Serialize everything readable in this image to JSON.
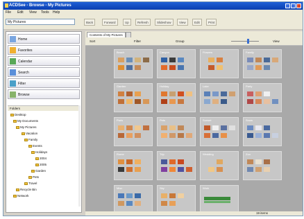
{
  "window": {
    "title": "ACDSee - Browse - My Pictures",
    "controls": [
      "minimize-icon",
      "maximize-icon",
      "close-icon"
    ]
  },
  "menu": [
    "File",
    "Edit",
    "View",
    "Tools",
    "Help"
  ],
  "toolbar": {
    "address": "My Pictures",
    "buttons": [
      "Back",
      "Forward",
      "Up",
      "Refresh",
      "Slideshow",
      "View",
      "Edit",
      "Print"
    ]
  },
  "nav": {
    "items": [
      "Home",
      "Favorites",
      "Calendar",
      "Search",
      "Filter",
      "Browse"
    ],
    "tree_header": "Folders",
    "tree": [
      "Desktop",
      "My Documents",
      "My Pictures",
      "Vacation",
      "Family",
      "Events",
      "Holidays",
      "2004",
      "2005",
      "Garden",
      "Pets",
      "Travel",
      "Recycle Bin",
      "Network"
    ]
  },
  "main": {
    "tab": "Contents of My Pictures",
    "tab2": "",
    "subbar_labels": [
      "Sort",
      "Filter",
      "Group",
      "View"
    ],
    "zoom_level": 0.6,
    "folders": [
      "Beach",
      "Canyon",
      "Flowers",
      "Family",
      "Garden",
      "Holiday",
      "Lake",
      "Party",
      "Paris",
      "Pets",
      "Sunset",
      "Snow",
      "Rome",
      "Trip",
      "Wedding",
      "Zoo",
      "Misc",
      "Sky",
      "Work"
    ]
  },
  "status": {
    "text": "19 items"
  },
  "colors": {
    "accent": "#1f5fd6",
    "content_bg": "#a9a9a9"
  }
}
